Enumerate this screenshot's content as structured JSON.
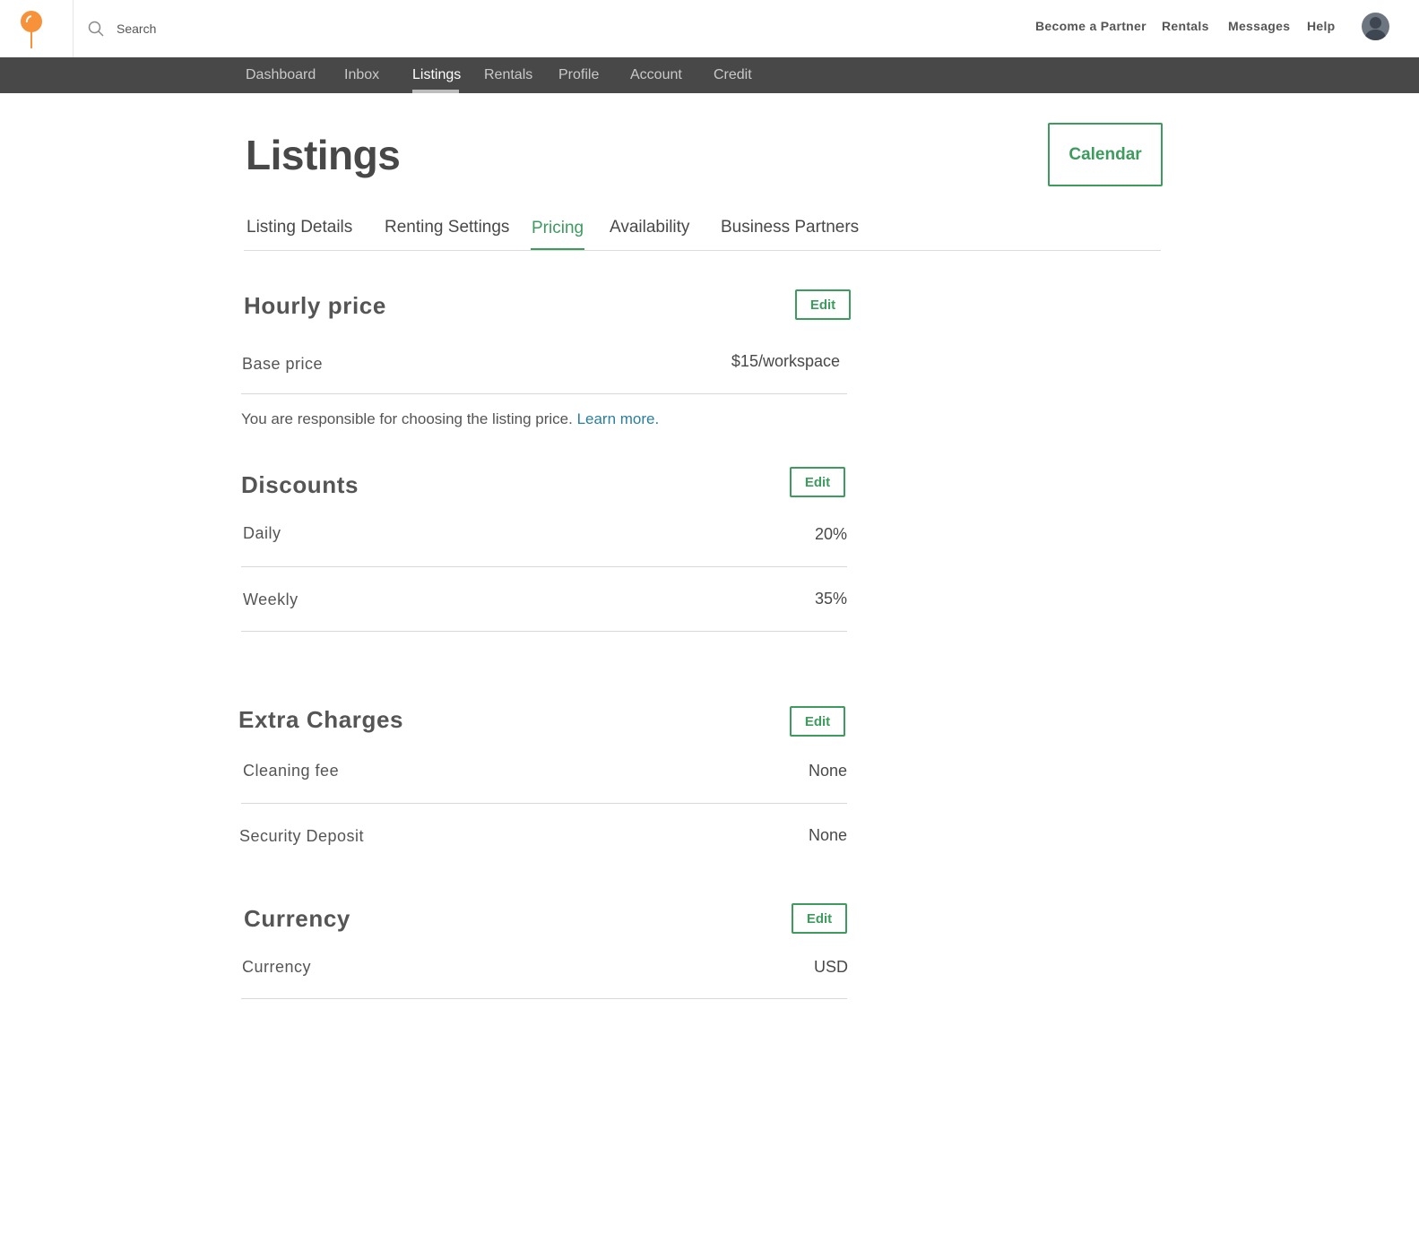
{
  "header": {
    "search_placeholder": "Search",
    "links": [
      "Become a Partner",
      "Rentals",
      "Messages",
      "Help"
    ]
  },
  "subnav": {
    "items": [
      "Dashboard",
      "Inbox",
      "Listings",
      "Rentals",
      "Profile",
      "Account",
      "Credit"
    ],
    "active": "Listings"
  },
  "page": {
    "title": "Listings",
    "calendar_label": "Calendar"
  },
  "tabs": {
    "items": [
      "Listing Details",
      "Renting Settings",
      "Pricing",
      "Availability",
      "Business Partners"
    ],
    "active": "Pricing"
  },
  "hourly": {
    "title": "Hourly price",
    "edit_label": "Edit",
    "base_label": "Base price",
    "base_value": "$15/workspace",
    "note": "You are responsible for choosing the listing price.",
    "learn_more": "Learn more."
  },
  "discounts": {
    "title": "Discounts",
    "edit_label": "Edit",
    "rows": [
      {
        "label": "Daily",
        "value": "20%"
      },
      {
        "label": "Weekly",
        "value": "35%"
      }
    ]
  },
  "extra": {
    "title": "Extra Charges",
    "edit_label": "Edit",
    "rows": [
      {
        "label": "Cleaning fee",
        "value": "None"
      },
      {
        "label": "Security Deposit",
        "value": "None"
      }
    ]
  },
  "currency": {
    "title": "Currency",
    "edit_label": "Edit",
    "rows": [
      {
        "label": "Currency",
        "value": "USD"
      }
    ]
  },
  "colors": {
    "accent_green": "#3d9b5e",
    "brand_orange": "#f7923a",
    "nav_dark": "#484848",
    "link_blue": "#2a7f9e"
  }
}
